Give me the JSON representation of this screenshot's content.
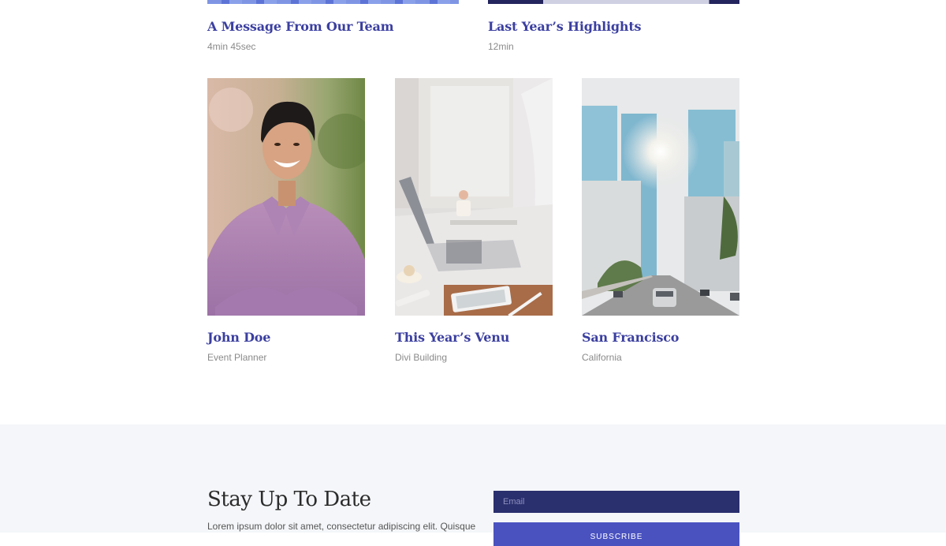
{
  "videos": [
    {
      "title": "A Message From Our Team",
      "duration": "4min 45sec"
    },
    {
      "title": "Last Year’s Highlights",
      "duration": "12min"
    }
  ],
  "cards": [
    {
      "title": "John Doe",
      "subtitle": "Event Planner",
      "image": "portrait-photo"
    },
    {
      "title": "This Year’s Venu",
      "subtitle": "Divi Building",
      "image": "workspace-laptop-photo"
    },
    {
      "title": "San Francisco",
      "subtitle": "California",
      "image": "city-street-photo"
    }
  ],
  "newsletter": {
    "heading": "Stay Up To Date",
    "text": "Lorem ipsum dolor sit amet, consectetur adipiscing elit. Quisque",
    "email_placeholder": "Email",
    "subscribe_label": "Subscribe"
  },
  "colors": {
    "title": "#3b3fa0",
    "email_field": "#2a2f6e",
    "subscribe_button": "#4a52c0",
    "section_background": "#f4f6f9"
  }
}
